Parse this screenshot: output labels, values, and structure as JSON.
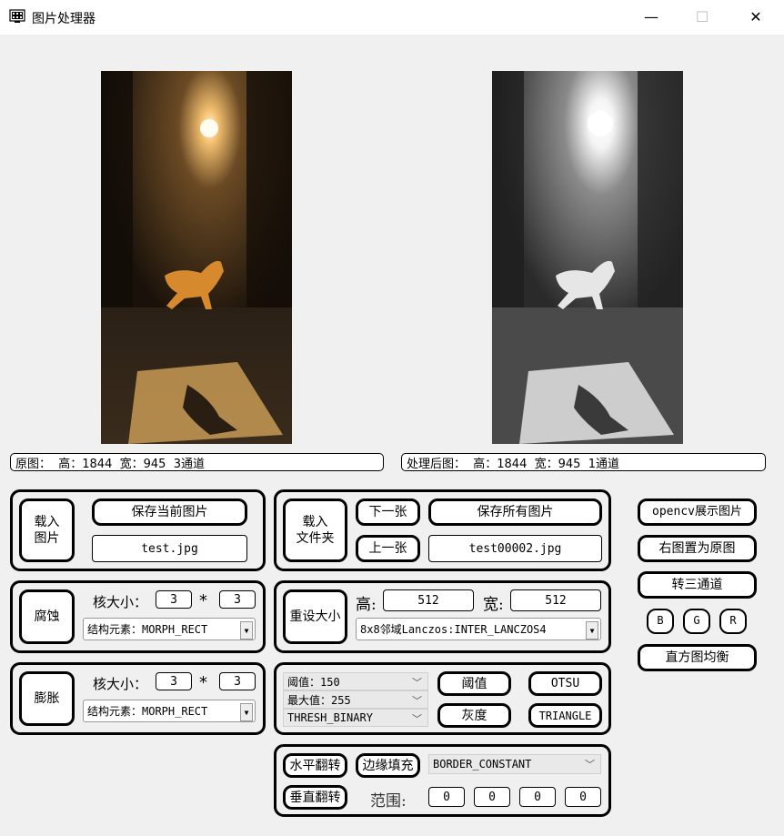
{
  "window": {
    "title": "图片处理器",
    "minimize_glyph": "—",
    "maximize_glyph": "☐",
    "close_glyph": "✕",
    "icon": "app-icon"
  },
  "images": {
    "original_info": "原图：  高：1844  宽：945  3通道",
    "processed_info": "处理后图：  高：1844  宽：945  1通道"
  },
  "load_group": {
    "load_image_button": "载入\n图片",
    "save_current_button": "保存当前图片",
    "current_filename": "test.jpg"
  },
  "folder_group": {
    "load_folder_button": "载入\n文件夹",
    "next_button": "下一张",
    "prev_button": "上一张",
    "save_all_button": "保存所有图片",
    "folder_filename": "test00002.jpg"
  },
  "erode_group": {
    "button": "腐蚀",
    "kernel_label": "核大小：",
    "kernel_w": "3",
    "times": "*",
    "kernel_h": "3",
    "struct_select": "结构元素：MORPH_RECT"
  },
  "dilate_group": {
    "button": "膨胀",
    "kernel_label": "核大小：",
    "kernel_w": "3",
    "times": "*",
    "kernel_h": "3",
    "struct_select": "结构元素：MORPH_RECT"
  },
  "resize_group": {
    "button": "重设大小",
    "height_label": "高:",
    "height_value": "512",
    "width_label": "宽:",
    "width_value": "512",
    "interp_select": "8x8邻域Lanczos:INTER_LANCZOS4"
  },
  "threshold_group": {
    "thresh_select": "阈值：150",
    "max_select": "最大值：255",
    "type_select": "THRESH_BINARY",
    "threshold_button": "阈值",
    "otsu_button": "OTSU",
    "gray_button": "灰度",
    "triangle_button": "TRIANGLE"
  },
  "border_group": {
    "hflip_button": "水平翻转",
    "border_fill_button": "边缘填充",
    "border_type_select": "BORDER_CONSTANT",
    "vflip_button": "垂直翻转",
    "range_label": "范围:",
    "range_values": [
      "0",
      "0",
      "0",
      "0"
    ]
  },
  "side_panel": {
    "opencv_show_button": "opencv展示图片",
    "set_as_original_button": "右图置为原图",
    "to_three_channel_button": "转三通道",
    "b_button": "B",
    "g_button": "G",
    "r_button": "R",
    "hist_eq_button": "直方图均衡"
  }
}
